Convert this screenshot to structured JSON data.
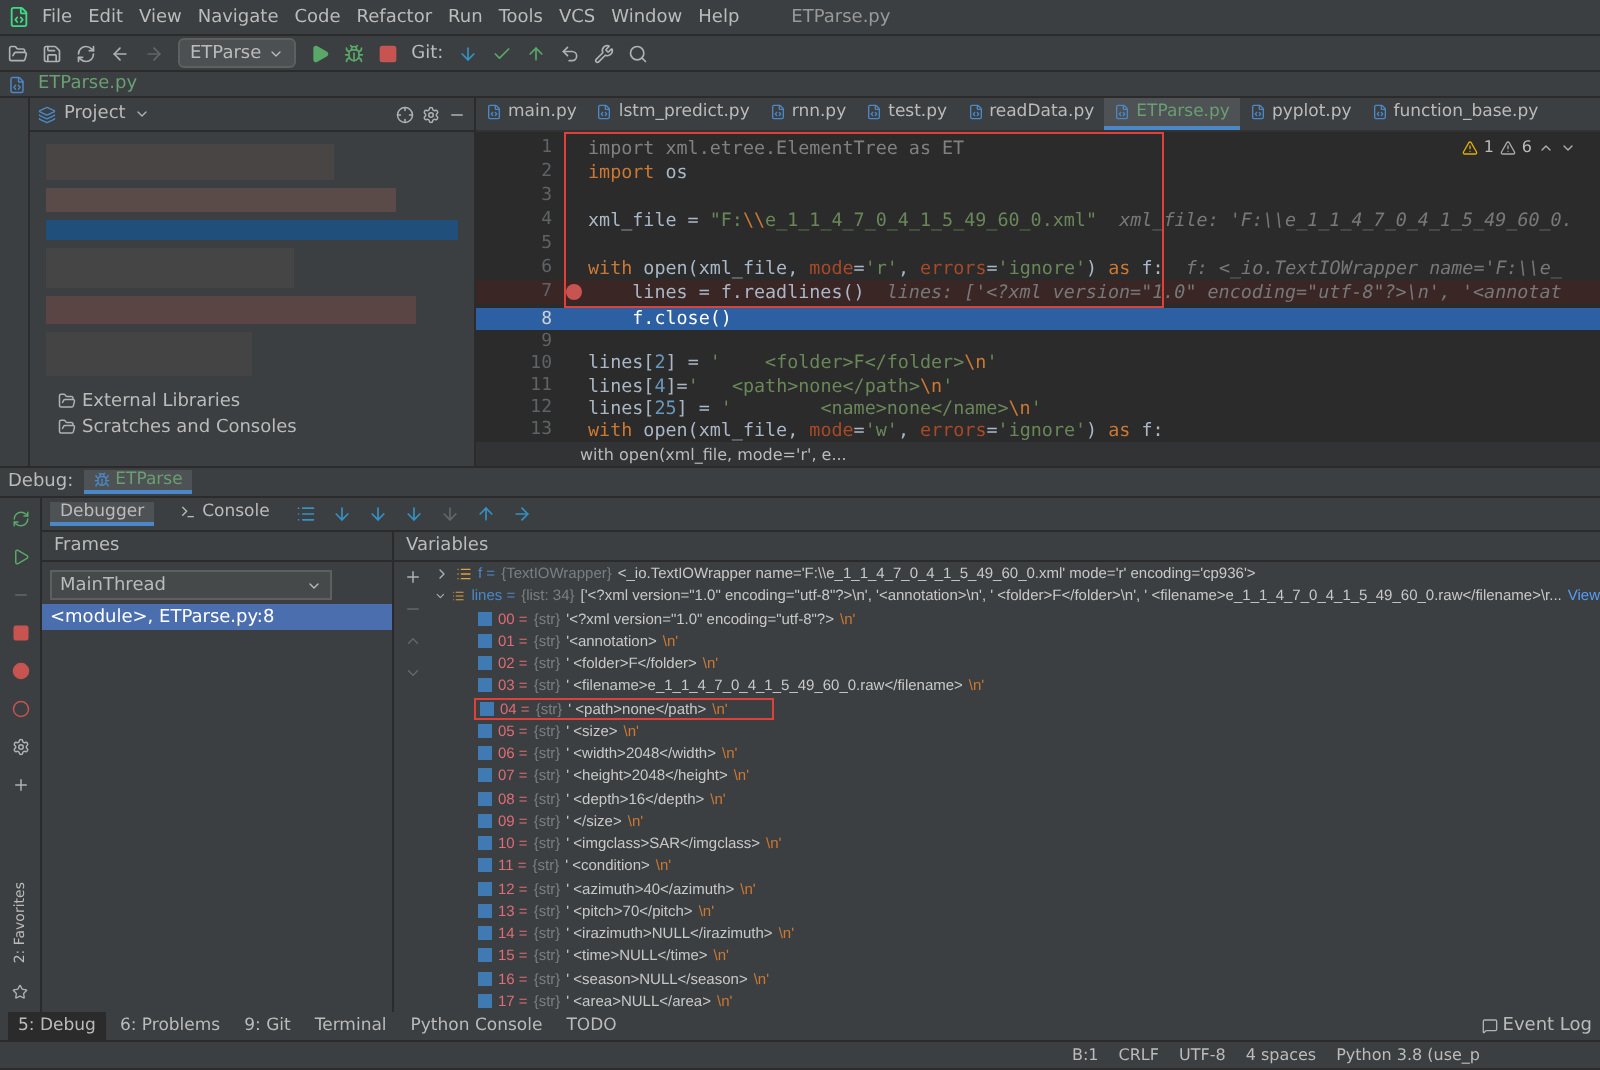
{
  "menu": [
    "File",
    "Edit",
    "View",
    "Navigate",
    "Code",
    "Refactor",
    "Run",
    "Tools",
    "VCS",
    "Window",
    "Help"
  ],
  "window": {
    "title": "ETParse.py"
  },
  "toolbar": {
    "run_config": "ETParse",
    "git_label": "Git:"
  },
  "breadcrumb": "ETParse.py",
  "project_panel": {
    "title": "Project",
    "items": [
      "External Libraries",
      "Scratches and Consoles"
    ]
  },
  "editor_tabs": [
    {
      "label": "main.py",
      "selected": false
    },
    {
      "label": "lstm_predict.py",
      "selected": false
    },
    {
      "label": "rnn.py",
      "selected": false
    },
    {
      "label": "test.py",
      "selected": false
    },
    {
      "label": "readData.py",
      "selected": false
    },
    {
      "label": "ETParse.py",
      "selected": true
    },
    {
      "label": "pyplot.py",
      "selected": false
    },
    {
      "label": "function_base.py",
      "selected": false
    }
  ],
  "inspections": {
    "warnings": "1",
    "weak_warnings": "6"
  },
  "code_lines": [
    {
      "no": "1",
      "boxed": true,
      "breakpoint": false,
      "current": false,
      "segments": [
        {
          "text": "import xml.etree.ElementTree as ET",
          "kind": "dim"
        }
      ]
    },
    {
      "no": "2",
      "boxed": true,
      "breakpoint": false,
      "current": false,
      "segments": [
        {
          "text": "import",
          "kind": "kw"
        },
        {
          "text": " os",
          "kind": "plain"
        }
      ]
    },
    {
      "no": "3",
      "boxed": true,
      "breakpoint": false,
      "current": false
    },
    {
      "no": "4",
      "boxed": true,
      "breakpoint": false,
      "current": false,
      "segments": [
        {
          "text": "xml_file = ",
          "kind": "plain"
        },
        {
          "text": "\"F:",
          "kind": "str"
        },
        {
          "text": "\\\\",
          "kind": "esc"
        },
        {
          "text": "e_1_1_4_7_0_4_1_5_49_60_0.xml\"",
          "kind": "str"
        },
        {
          "text": "  xml_file: 'F:\\\\e_1_1_4_7_0_4_1_5_49_60_0.",
          "kind": "hint"
        }
      ]
    },
    {
      "no": "5",
      "boxed": true,
      "breakpoint": false,
      "current": false
    },
    {
      "no": "6",
      "boxed": true,
      "breakpoint": false,
      "current": false,
      "segments": [
        {
          "text": "with ",
          "kind": "kw"
        },
        {
          "text": "open(xml_file, ",
          "kind": "plain"
        },
        {
          "text": "mode",
          "kind": "param"
        },
        {
          "text": "=",
          "kind": "plain"
        },
        {
          "text": "'r'",
          "kind": "str"
        },
        {
          "text": ", ",
          "kind": "plain"
        },
        {
          "text": "errors",
          "kind": "param"
        },
        {
          "text": "=",
          "kind": "plain"
        },
        {
          "text": "'ignore'",
          "kind": "str"
        },
        {
          "text": ") ",
          "kind": "plain"
        },
        {
          "text": "as",
          "kind": "kw"
        },
        {
          "text": " f:",
          "kind": "plain"
        },
        {
          "text": "  f: <_io.TextIOWrapper name='F:\\\\e_",
          "kind": "hint"
        }
      ]
    },
    {
      "no": "7",
      "boxed": true,
      "breakpoint": true,
      "current": false,
      "segments": [
        {
          "text": "    lines = f.readlines()",
          "kind": "plain"
        },
        {
          "text": "  lines: ['<?xml version=\"1.0\" encoding=\"utf-8\"?>\\n', '<annotat",
          "kind": "hint"
        }
      ]
    },
    {
      "no": "8",
      "boxed": false,
      "breakpoint": false,
      "current": true,
      "segments": [
        {
          "text": "    f.close()",
          "kind": "plain"
        }
      ]
    },
    {
      "no": "9",
      "boxed": false,
      "breakpoint": false,
      "current": false
    },
    {
      "no": "10",
      "boxed": false,
      "breakpoint": false,
      "current": false,
      "segments": [
        {
          "text": "lines[",
          "kind": "plain"
        },
        {
          "text": "2",
          "kind": "num"
        },
        {
          "text": "] = ",
          "kind": "plain"
        },
        {
          "text": "'    <folder>F</folder>",
          "kind": "str"
        },
        {
          "text": "\\n",
          "kind": "esc"
        },
        {
          "text": "'",
          "kind": "str"
        }
      ]
    },
    {
      "no": "11",
      "boxed": false,
      "breakpoint": false,
      "current": false,
      "segments": [
        {
          "text": "lines[",
          "kind": "plain"
        },
        {
          "text": "4",
          "kind": "num"
        },
        {
          "text": "]=",
          "kind": "plain"
        },
        {
          "text": "'   <path>none</path>",
          "kind": "str"
        },
        {
          "text": "\\n",
          "kind": "esc"
        },
        {
          "text": "'",
          "kind": "str"
        }
      ]
    },
    {
      "no": "12",
      "boxed": false,
      "breakpoint": false,
      "current": false,
      "segments": [
        {
          "text": "lines[",
          "kind": "plain"
        },
        {
          "text": "25",
          "kind": "num"
        },
        {
          "text": "] = ",
          "kind": "plain"
        },
        {
          "text": "'        <name>none</name>",
          "kind": "str"
        },
        {
          "text": "\\n",
          "kind": "esc"
        },
        {
          "text": "'",
          "kind": "str"
        }
      ]
    },
    {
      "no": "13",
      "boxed": false,
      "breakpoint": false,
      "current": false,
      "segments": [
        {
          "text": "with ",
          "kind": "kw"
        },
        {
          "text": "open(xml_file, ",
          "kind": "plain"
        },
        {
          "text": "mode",
          "kind": "param"
        },
        {
          "text": "=",
          "kind": "plain"
        },
        {
          "text": "'w'",
          "kind": "str"
        },
        {
          "text": ", ",
          "kind": "plain"
        },
        {
          "text": "errors",
          "kind": "param"
        },
        {
          "text": "=",
          "kind": "plain"
        },
        {
          "text": "'ignore'",
          "kind": "str"
        },
        {
          "text": ") ",
          "kind": "plain"
        },
        {
          "text": "as",
          "kind": "kw"
        },
        {
          "text": " f:",
          "kind": "plain"
        }
      ]
    }
  ],
  "editor_breadcrumb": "with open(xml_file, mode='r', e...",
  "debug": {
    "label": "Debug:",
    "session": "ETParse",
    "tabs": [
      {
        "label": "Debugger",
        "selected": true
      },
      {
        "label": "Console",
        "selected": false
      }
    ],
    "frames_title": "Frames",
    "thread": "MainThread",
    "frames": [
      {
        "label": "<module>, ETParse.py:8",
        "selected": true
      }
    ],
    "variables_title": "Variables",
    "variables": [
      {
        "name": "f =",
        "type": "{TextIOWrapper}",
        "value": "<_io.TextIOWrapper name='F:\\\\e_1_1_4_7_0_4_1_5_49_60_0.xml' mode='r' encoding='cp936'>",
        "expanded": false
      },
      {
        "name": "lines =",
        "type": "{list: 34}",
        "value": "['<?xml version=\"1.0\" encoding=\"utf-8\"?>\\n', '<annotation>\\n', '    <folder>F</folder>\\n', '    <filename>e_1_1_4_7_0_4_1_5_49_60_0.raw</filename>\\r...",
        "link": "View",
        "expanded": true,
        "children": [
          {
            "name": "00 =",
            "type": "{str}",
            "value": "'<?xml version=\"1.0\" encoding=\"utf-8\"?>",
            "esc": "\\n'",
            "marked": false
          },
          {
            "name": "01 =",
            "type": "{str}",
            "value": "'<annotation>",
            "esc": "\\n'",
            "marked": false
          },
          {
            "name": "02 =",
            "type": "{str}",
            "value": "'    <folder>F</folder>",
            "esc": "\\n'",
            "marked": false
          },
          {
            "name": "03 =",
            "type": "{str}",
            "value": "'    <filename>e_1_1_4_7_0_4_1_5_49_60_0.raw</filename>",
            "esc": "\\n'",
            "marked": false
          },
          {
            "name": "04 =",
            "type": "{str}",
            "value": "'    <path>none</path>",
            "esc": "\\n'",
            "marked": true
          },
          {
            "name": "05 =",
            "type": "{str}",
            "value": "'    <size>",
            "esc": "\\n'",
            "marked": false
          },
          {
            "name": "06 =",
            "type": "{str}",
            "value": "'        <width>2048</width>",
            "esc": "\\n'",
            "marked": false
          },
          {
            "name": "07 =",
            "type": "{str}",
            "value": "'        <height>2048</height>",
            "esc": "\\n'",
            "marked": false
          },
          {
            "name": "08 =",
            "type": "{str}",
            "value": "'        <depth>16</depth>",
            "esc": "\\n'",
            "marked": false
          },
          {
            "name": "09 =",
            "type": "{str}",
            "value": "'    </size>",
            "esc": "\\n'",
            "marked": false
          },
          {
            "name": "10 =",
            "type": "{str}",
            "value": "'    <imgclass>SAR</imgclass>",
            "esc": "\\n'",
            "marked": false
          },
          {
            "name": "11 =",
            "type": "{str}",
            "value": "'    <condition>",
            "esc": "\\n'",
            "marked": false
          },
          {
            "name": "12 =",
            "type": "{str}",
            "value": "'        <azimuth>40</azimuth>",
            "esc": "\\n'",
            "marked": false
          },
          {
            "name": "13 =",
            "type": "{str}",
            "value": "'        <pitch>70</pitch>",
            "esc": "\\n'",
            "marked": false
          },
          {
            "name": "14 =",
            "type": "{str}",
            "value": "'        <irazimuth>NULL</irazimuth>",
            "esc": "\\n'",
            "marked": false
          },
          {
            "name": "15 =",
            "type": "{str}",
            "value": "'        <time>NULL</time>",
            "esc": "\\n'",
            "marked": false
          },
          {
            "name": "16 =",
            "type": "{str}",
            "value": "'        <season>NULL</season>",
            "esc": "\\n'",
            "marked": false
          },
          {
            "name": "17 =",
            "type": "{str}",
            "value": "'        <area>NULL</area>",
            "esc": "\\n'",
            "marked": false
          }
        ]
      }
    ]
  },
  "side_label": "2: Favorites",
  "bottom_tabs": [
    {
      "label": "5: Debug",
      "selected": true
    },
    {
      "label": "6: Problems",
      "selected": false
    },
    {
      "label": "9: Git",
      "selected": false
    },
    {
      "label": "Terminal",
      "selected": false
    },
    {
      "label": "Python Console",
      "selected": false
    },
    {
      "label": "TODO",
      "selected": false
    }
  ],
  "event_log": "Event Log",
  "status_bar": [
    "B:1",
    "CRLF",
    "UTF-8",
    "4 spaces",
    "Python 3.8 (use_p"
  ]
}
